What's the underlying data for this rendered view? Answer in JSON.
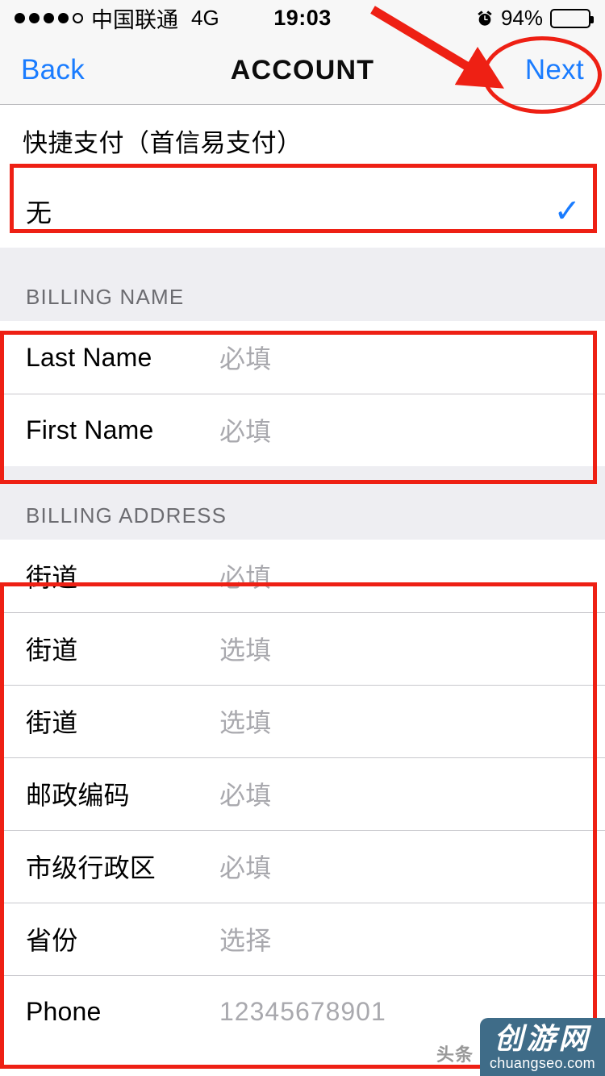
{
  "status_bar": {
    "signal_dots_filled": 4,
    "signal_dots_total": 5,
    "carrier": "中国联通",
    "network": "4G",
    "time": "19:03",
    "battery_percent": "94%",
    "alarm_icon": "alarm-clock-icon"
  },
  "nav": {
    "back_label": "Back",
    "title": "ACCOUNT",
    "next_label": "Next"
  },
  "form": {
    "group_title": "快捷支付（首信易支付）",
    "payment_row": {
      "label": "无",
      "check_icon": "checkmark-icon"
    },
    "billing_name": {
      "header": "BILLING NAME",
      "rows": [
        {
          "label": "Last Name",
          "placeholder": "必填"
        },
        {
          "label": "First Name",
          "placeholder": "必填"
        }
      ]
    },
    "billing_address": {
      "header": "BILLING ADDRESS",
      "rows": [
        {
          "label": "街道",
          "placeholder": "必填"
        },
        {
          "label": "街道",
          "placeholder": "选填"
        },
        {
          "label": "街道",
          "placeholder": "选填"
        },
        {
          "label": "邮政编码",
          "placeholder": "必填"
        },
        {
          "label": "市级行政区",
          "placeholder": "必填"
        },
        {
          "label": "省份",
          "placeholder": "选择"
        },
        {
          "label": "Phone",
          "placeholder": "12345678901"
        }
      ]
    }
  },
  "watermark": {
    "brand_cn": "创游网",
    "url": "chuangseo.com",
    "ghost_text": "头条"
  },
  "colors": {
    "accent_blue": "#1a7cff",
    "annotation_red": "#ee2014",
    "group_bg": "#eeeef2",
    "placeholder_gray": "#a9a9ae",
    "watermark_bg": "#3f6c88"
  }
}
